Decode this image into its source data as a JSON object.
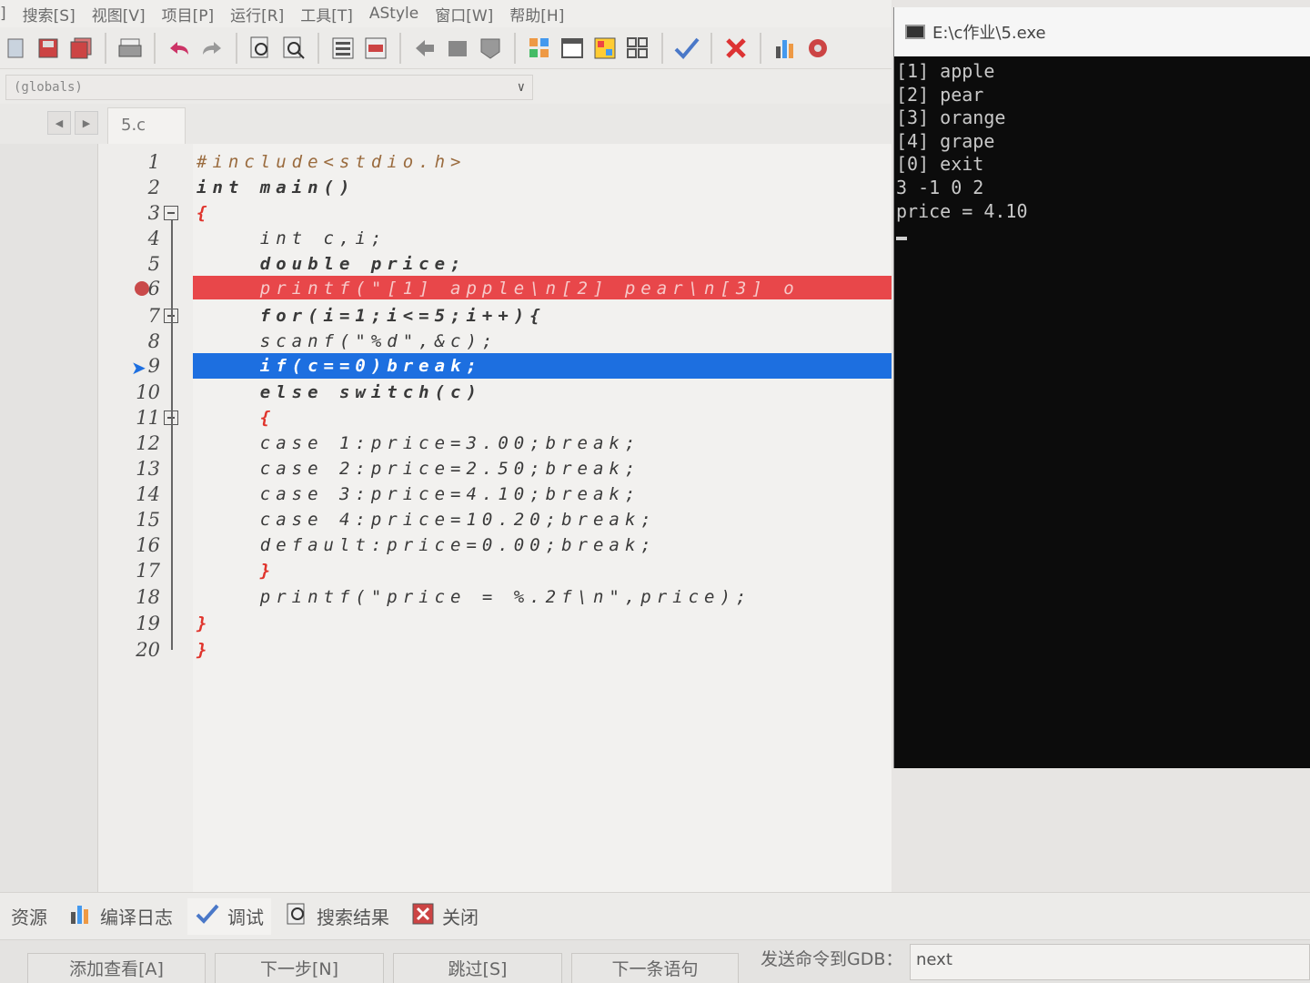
{
  "menu": {
    "items": [
      "]",
      "搜索[S]",
      "视图[V]",
      "项目[P]",
      "运行[R]",
      "工具[T]",
      "AStyle",
      "窗口[W]",
      "帮助[H]"
    ]
  },
  "toolbar": {
    "icons": [
      "new-file-icon",
      "save-icon",
      "save-all-icon",
      "print-icon",
      "undo-icon",
      "redo-icon",
      "find-icon",
      "replace-icon",
      "indent-icon",
      "unindent-icon",
      "back-icon",
      "forward-icon",
      "bookmark-icon",
      "grid-icon",
      "window-icon",
      "layout-icon",
      "tiles-icon",
      "check-icon",
      "close-x-icon",
      "chart-icon",
      "profile-icon"
    ]
  },
  "scope": {
    "value": "(globals)"
  },
  "tabs": {
    "file": "5.c"
  },
  "editor": {
    "lines": [
      {
        "n": "1",
        "text": "#include<stdio.h>"
      },
      {
        "n": "2",
        "text": "int main()"
      },
      {
        "n": "3",
        "text": "{"
      },
      {
        "n": "4",
        "text": "    int c,i;"
      },
      {
        "n": "5",
        "text": "    double price;"
      },
      {
        "n": "6",
        "text": "    printf(\"[1] apple\\n[2] pear\\n[3] o"
      },
      {
        "n": "7",
        "text": "    for(i=1;i<=5;i++){"
      },
      {
        "n": "8",
        "text": "    scanf(\"%d\",&c);"
      },
      {
        "n": "9",
        "text": "    if(c==0)break;"
      },
      {
        "n": "10",
        "text": "    else switch(c)"
      },
      {
        "n": "11",
        "text": "    {"
      },
      {
        "n": "12",
        "text": "    case 1:price=3.00;break;"
      },
      {
        "n": "13",
        "text": "    case 2:price=2.50;break;"
      },
      {
        "n": "14",
        "text": "    case 3:price=4.10;break;"
      },
      {
        "n": "15",
        "text": "    case 4:price=10.20;break;"
      },
      {
        "n": "16",
        "text": "    default:price=0.00;break;"
      },
      {
        "n": "17",
        "text": "    }"
      },
      {
        "n": "18",
        "text": "    printf(\"price = %.2f\\n\",price);"
      },
      {
        "n": "19",
        "text": "}"
      },
      {
        "n": "20",
        "text": "}"
      }
    ],
    "breakpoint_line": "6",
    "current_line": "9"
  },
  "console": {
    "title": "E:\\c作业\\5.exe",
    "lines": [
      "[1] apple",
      "[2] pear",
      "[3] orange",
      "[4] grape",
      "[0] exit",
      "3 -1 0 2",
      "price = 4.10"
    ]
  },
  "bottom_tabs": {
    "resources": "资源",
    "compile_log": "编译日志",
    "debug": "调试",
    "search_results": "搜索结果",
    "close": "关闭"
  },
  "debug_bar": {
    "add_watch": "添加查看[A]",
    "next_step": "下一步[N]",
    "skip": "跳过[S]",
    "next_statement": "下一条语句",
    "gdb_label": "发送命令到GDB：",
    "gdb_value": "next"
  },
  "colors": {
    "breakpoint_red": "#e8474a",
    "current_line_blue": "#1d6fe0",
    "console_bg": "#0c0c0c"
  }
}
